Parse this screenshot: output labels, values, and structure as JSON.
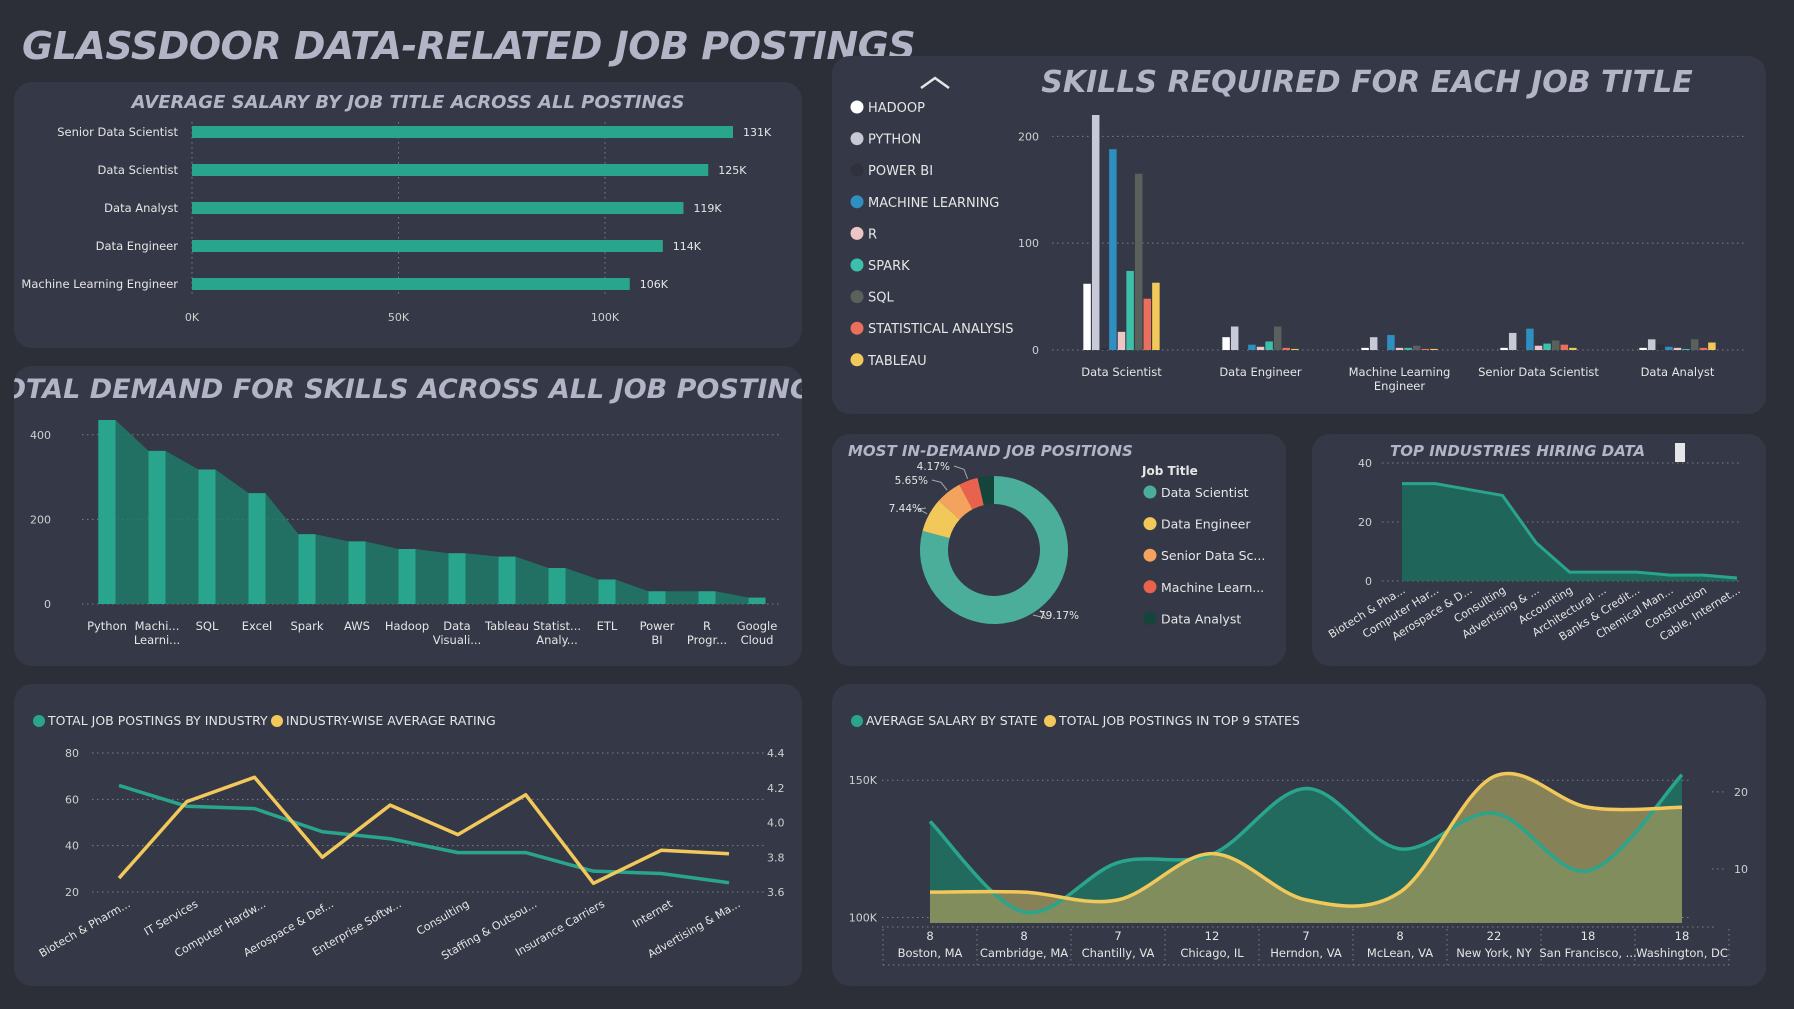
{
  "page": {
    "title": "GLASSDOOR DATA-RELATED JOB POSTINGS"
  },
  "colors": {
    "bg": "#2c2e38",
    "card": "#353846",
    "teal": "#2aa58d",
    "yellow": "#f2c85b",
    "titlegray": "#b3b5c7"
  },
  "chart_data": [
    {
      "id": "avg_salary_by_title",
      "type": "bar",
      "orientation": "horizontal",
      "title": "AVERAGE SALARY BY JOB TITLE ACROSS ALL POSTINGS",
      "categories": [
        "Senior Data Scientist",
        "Data Scientist",
        "Data Analyst",
        "Data Engineer",
        "Machine Learning Engineer"
      ],
      "values": [
        131,
        125,
        119,
        114,
        106
      ],
      "data_labels": [
        "131K",
        "125K",
        "119K",
        "114K",
        "106K"
      ],
      "x_ticks": [
        0,
        50,
        100
      ],
      "x_tick_labels": [
        "0K",
        "50K",
        "100K"
      ],
      "xlim": [
        0,
        131
      ],
      "color": "#2aa58d"
    },
    {
      "id": "skills_by_title",
      "type": "bar",
      "title": "SKILLS REQUIRED FOR EACH JOB TITLE",
      "categories": [
        "Data Scientist",
        "Data Engineer",
        "Machine Learning Engineer",
        "Senior Data Scientist",
        "Data Analyst"
      ],
      "category_lines": [
        [
          "Data Scientist"
        ],
        [
          "Data Engineer"
        ],
        [
          "Machine Learning",
          "Engineer"
        ],
        [
          "Senior Data Scientist"
        ],
        [
          "Data Analyst"
        ]
      ],
      "series": [
        {
          "name": "HADOOP",
          "color": "#ffffff",
          "values": [
            62,
            12,
            2,
            2,
            2
          ]
        },
        {
          "name": "PYTHON",
          "color": "#c8c9d6",
          "values": [
            220,
            22,
            12,
            16,
            10
          ]
        },
        {
          "name": "POWER BI",
          "color": "#2f323d",
          "values": [
            2,
            1,
            1,
            1,
            5
          ]
        },
        {
          "name": "MACHINE LEARNING",
          "color": "#2f8fc1",
          "values": [
            188,
            5,
            14,
            20,
            3
          ]
        },
        {
          "name": "R",
          "color": "#ecc5c5",
          "values": [
            17,
            3,
            2,
            4,
            2
          ]
        },
        {
          "name": "SPARK",
          "color": "#3bc1a9",
          "values": [
            74,
            8,
            2,
            6,
            1
          ]
        },
        {
          "name": "SQL",
          "color": "#59615d",
          "values": [
            165,
            22,
            4,
            9,
            10
          ]
        },
        {
          "name": "STATISTICAL ANALYSIS",
          "color": "#eb6f5a",
          "values": [
            48,
            2,
            1,
            5,
            2
          ]
        },
        {
          "name": "TABLEAU",
          "color": "#f2c85b",
          "values": [
            63,
            1,
            1,
            2,
            7
          ]
        }
      ],
      "y_ticks": [
        0,
        100,
        200
      ],
      "ylim": [
        0,
        220
      ],
      "legend_position": "left"
    },
    {
      "id": "skills_demand",
      "type": "bar",
      "title": "TOTAL DEMAND FOR SKILLS ACROSS ALL JOB POSTINGS",
      "categories": [
        "Python",
        "Machine Learning",
        "SQL",
        "Excel",
        "Spark",
        "AWS",
        "Hadoop",
        "Data Visualization",
        "Tableau",
        "Statistical Analysis",
        "ETL",
        "Power BI",
        "R Programming",
        "Google Cloud"
      ],
      "category_lines": [
        [
          "Python"
        ],
        [
          "Machi...",
          "Learni..."
        ],
        [
          "SQL"
        ],
        [
          "Excel"
        ],
        [
          "Spark"
        ],
        [
          "AWS"
        ],
        [
          "Hadoop"
        ],
        [
          "Data",
          "Visuali..."
        ],
        [
          "Tableau"
        ],
        [
          "Statist...",
          "Analy..."
        ],
        [
          "ETL"
        ],
        [
          "Power",
          "BI"
        ],
        [
          "R",
          "Progr..."
        ],
        [
          "Google",
          "Cloud"
        ]
      ],
      "values": [
        435,
        362,
        318,
        262,
        165,
        148,
        130,
        120,
        112,
        85,
        58,
        30,
        30,
        15
      ],
      "y_ticks": [
        0,
        200,
        400
      ],
      "ylim": [
        0,
        435
      ],
      "color": "#2aa58d"
    },
    {
      "id": "job_positions",
      "type": "pie",
      "variant": "donut",
      "title": "MOST IN-DEMAND JOB POSITIONS",
      "legend_title": "Job Title",
      "categories": [
        "Data Scientist",
        "Data Engineer",
        "Senior Data Scientist",
        "Machine Learning Engineer",
        "Data Analyst"
      ],
      "legend_labels": [
        "Data Scientist",
        "Data Engineer",
        "Senior Data Sc...",
        "Machine Learn...",
        "Data Analyst"
      ],
      "values": [
        79.17,
        7.44,
        5.65,
        4.17,
        3.57
      ],
      "data_labels": [
        "79.17%",
        "7.44%",
        "5.65%",
        "4.17%",
        ""
      ],
      "colors": [
        "#4aae9b",
        "#f2c85b",
        "#f3a35d",
        "#e8624d",
        "#13453b"
      ]
    },
    {
      "id": "top_industries",
      "type": "area",
      "title": "TOP INDUSTRIES HIRING DATA",
      "categories": [
        "Biotech & Pha...",
        "Computer Har...",
        "Aerospace & D...",
        "Consulting",
        "Advertising & ...",
        "Accounting",
        "Architectural ...",
        "Banks & Credit...",
        "Chemical Man...",
        "Construction",
        "Cable, Internet..."
      ],
      "values": [
        33,
        33,
        31,
        29,
        13,
        3,
        3,
        3,
        2,
        2,
        1
      ],
      "y_ticks": [
        0,
        20,
        40
      ],
      "ylim": [
        0,
        40
      ],
      "color": "#2aa58d"
    },
    {
      "id": "industry_postings_rating",
      "type": "line",
      "categories": [
        "Biotech & Pharm...",
        "IT Services",
        "Computer Hardw...",
        "Aerospace & Def...",
        "Enterprise Softw...",
        "Consulting",
        "Staffing & Outsou...",
        "Insurance Carriers",
        "Internet",
        "Advertising & Ma..."
      ],
      "series": [
        {
          "name": "TOTAL JOB POSTINGS BY INDUSTRY",
          "axis": "left",
          "color": "#2aa58d",
          "values": [
            66,
            57,
            56,
            46,
            43,
            37,
            37,
            29,
            28,
            24
          ]
        },
        {
          "name": "INDUSTRY-WISE AVERAGE RATING",
          "axis": "right",
          "color": "#f2c85b",
          "values": [
            3.68,
            4.12,
            4.26,
            3.8,
            4.1,
            3.93,
            4.16,
            3.65,
            3.84,
            3.82
          ]
        }
      ],
      "y_left_ticks": [
        20,
        40,
        60,
        80
      ],
      "y_left_lim": [
        20,
        80
      ],
      "y_right_ticks": [
        3.6,
        3.8,
        4.0,
        4.2,
        4.4
      ],
      "y_right_tick_labels": [
        "3.6",
        "3.8",
        "4.0",
        "4.2",
        "4.4"
      ],
      "y_right_lim": [
        3.6,
        4.4
      ],
      "legend_position": "top-left"
    },
    {
      "id": "state_salary_postings",
      "type": "area",
      "categories": [
        "Boston, MA",
        "Cambridge, MA",
        "Chantilly, VA",
        "Chicago, IL",
        "Herndon, VA",
        "McLean, VA",
        "New York, NY",
        "San Francisco, ...",
        "Washington, DC"
      ],
      "category_counts": [
        "8",
        "8",
        "7",
        "12",
        "7",
        "8",
        "22",
        "18",
        "18"
      ],
      "series": [
        {
          "name": "AVERAGE SALARY BY STATE",
          "axis": "left",
          "color": "#2aa58d",
          "values": [
            135,
            102,
            120,
            123,
            147,
            125,
            138,
            117,
            152
          ]
        },
        {
          "name": "TOTAL JOB POSTINGS IN TOP 9 STATES",
          "axis": "right",
          "color": "#f2c85b",
          "values": [
            7,
            7,
            6,
            12,
            6,
            7,
            22,
            18,
            18
          ]
        }
      ],
      "y_left_ticks": [
        100,
        150
      ],
      "y_left_tick_labels": [
        "100K",
        "150K"
      ],
      "y_left_lim": [
        98,
        157
      ],
      "y_right_ticks": [
        10,
        20
      ],
      "y_right_lim": [
        3,
        24
      ],
      "legend_position": "top-left"
    }
  ]
}
